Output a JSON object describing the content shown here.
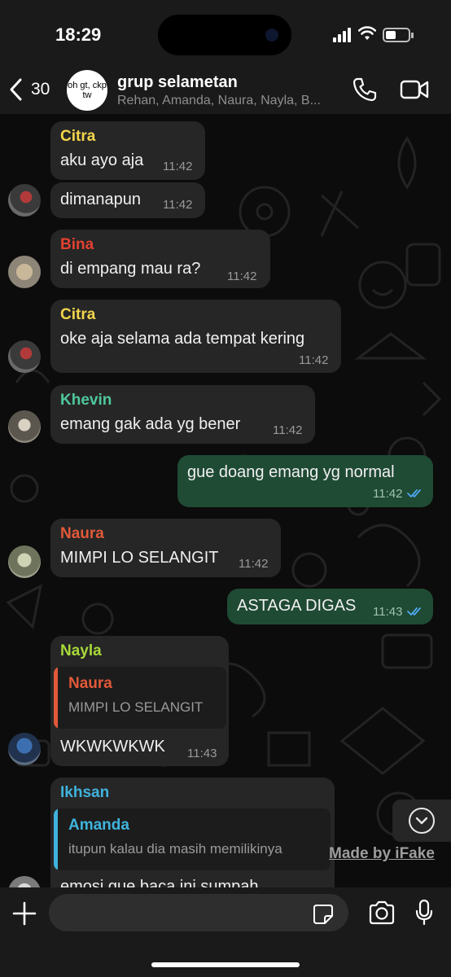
{
  "status": {
    "time": "18:29",
    "battery_level": 0.45
  },
  "header": {
    "back_count": "30",
    "group_avatar_text": "oh gt, ckp tw",
    "title": "grup selametan",
    "subtitle": "Rehan, Amanda, Naura, Nayla, B..."
  },
  "colors": {
    "citra": "#f3d54a",
    "bina": "#e2402f",
    "khevin": "#4fc79b",
    "naura": "#e2593a",
    "nayla": "#a8d93a",
    "ikhsan": "#3fb3dd",
    "amanda": "#3fb3dd",
    "outgoing_bubble": "#1f4a34",
    "incoming_bubble": "#262626"
  },
  "messages": [
    {
      "sender": "Citra",
      "text": "aku ayo aja",
      "time": "11:42"
    },
    {
      "text": "dimanapun",
      "time": "11:42"
    },
    {
      "sender": "Bina",
      "text": "di empang mau ra?",
      "time": "11:42"
    },
    {
      "sender": "Citra",
      "text": "oke aja selama ada tempat kering",
      "time": "11:42"
    },
    {
      "sender": "Khevin",
      "text": "emang gak ada yg bener",
      "time": "11:42"
    },
    {
      "text": "gue doang emang yg normal",
      "time": "11:42"
    },
    {
      "sender": "Naura",
      "text": "MIMPI LO SELANGIT",
      "time": "11:42"
    },
    {
      "text": "ASTAGA DIGAS",
      "time": "11:43"
    },
    {
      "sender": "Nayla",
      "quote_name": "Naura",
      "quote_text": "MIMPI LO SELANGIT",
      "text": "WKWKWKWK",
      "time": "11:43"
    },
    {
      "sender": "Ikhsan",
      "quote_name": "Amanda",
      "quote_text": "itupun kalau dia masih memilikinya",
      "text": "emosi gue baca ini sumpah"
    }
  ],
  "watermark": "Made by iFake",
  "composer": {
    "placeholder": ""
  }
}
